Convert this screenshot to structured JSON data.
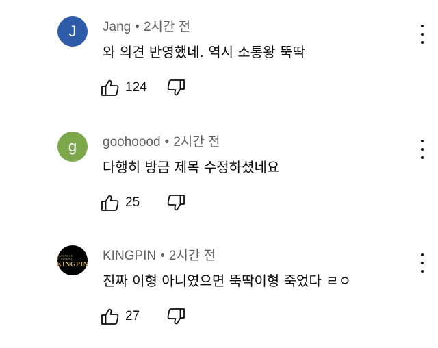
{
  "comments": [
    {
      "avatar_letter": "J",
      "avatar_color": "#2f5ca8",
      "author": "Jang",
      "separator": "•",
      "time": "2시간 전",
      "text": "와 의견 반영했네. 역시 소통왕 뚝딱",
      "likes": "124"
    },
    {
      "avatar_letter": "g",
      "avatar_color": "#7ca74a",
      "author": "goohoood",
      "separator": "•",
      "time": "2시간 전",
      "text": "다행히 방금 제목 수정하셨네요",
      "likes": "25"
    },
    {
      "avatar_logo_sub": "JAPANESE CONVENT",
      "avatar_logo": "KINGPIN",
      "avatar_color": "#000000",
      "author": "KINGPIN",
      "separator": "•",
      "time": "2시간 전",
      "text": "진짜 이형 아니였으면 뚝딱이형 죽었다 ㄹㅇ",
      "likes": "27"
    }
  ],
  "icons": {
    "like": "thumbs-up-icon",
    "dislike": "thumbs-down-icon",
    "more": "more-vertical-icon"
  }
}
